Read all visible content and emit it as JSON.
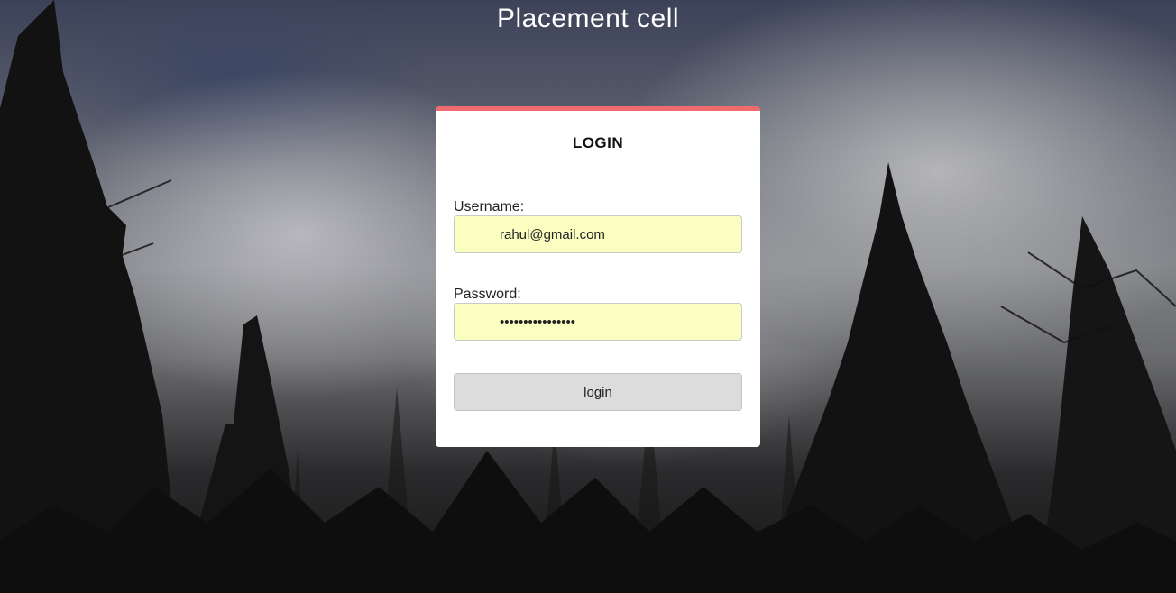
{
  "page": {
    "title": "Placement cell"
  },
  "login_card": {
    "heading": "LOGIN",
    "username_label": "Username:",
    "username_value": "rahul@gmail.com",
    "password_label": "Password:",
    "password_value": "rahulpassword123",
    "submit_label": "login"
  },
  "colors": {
    "card_accent": "#ef6b6e",
    "input_autofill_bg": "#fafec0",
    "button_bg": "#dcdcdc"
  }
}
